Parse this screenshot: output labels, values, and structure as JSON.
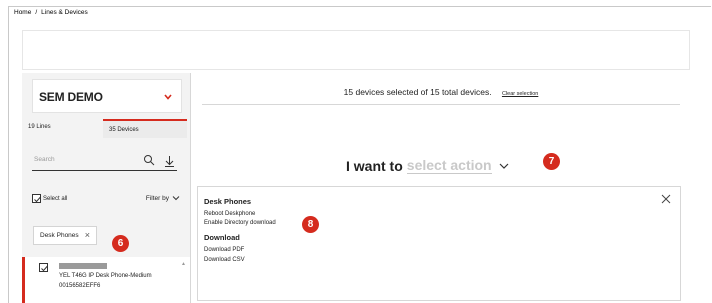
{
  "breadcrumb": {
    "home": "Home",
    "sep": "/",
    "current": "Lines & Devices"
  },
  "account": {
    "name": "SEM DEMO"
  },
  "tabs": [
    {
      "label": "19 Lines"
    },
    {
      "label": "35 Devices"
    }
  ],
  "search": {
    "placeholder": "Search"
  },
  "list_controls": {
    "select_all": "Select all",
    "filter_by": "Filter by"
  },
  "chip": {
    "label": "Desk Phones"
  },
  "device": {
    "name": "YEL T46G IP Desk Phone-Medium",
    "id": "00156582EFF6"
  },
  "selection": {
    "text": "15 devices selected of 15 total devices.",
    "clear": "Clear selection"
  },
  "action": {
    "prefix": "I want to",
    "placeholder": "select action"
  },
  "panel": {
    "section1": "Desk Phones",
    "options1": [
      "Reboot Deskphone",
      "Enable Directory download"
    ],
    "section2": "Download",
    "options2": [
      "Download PDF",
      "Download CSV"
    ]
  },
  "badges": {
    "b6": "6",
    "b7": "7",
    "b8": "8"
  },
  "colors": {
    "accent": "#d52b1e"
  },
  "icons": [
    "chevron-down-icon",
    "search-icon",
    "download-icon",
    "check-icon",
    "close-icon"
  ]
}
